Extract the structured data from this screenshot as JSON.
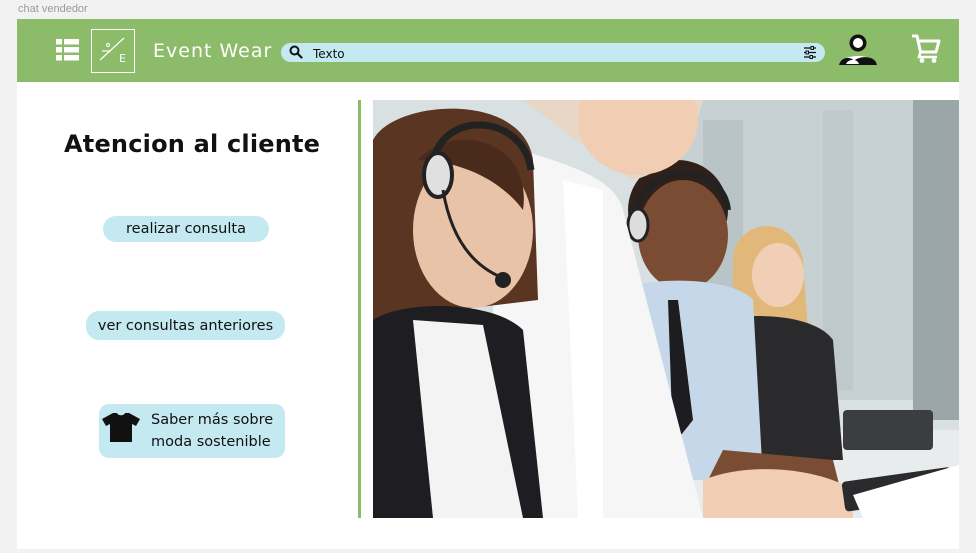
{
  "frame": {
    "label": "chat vendedor"
  },
  "header": {
    "brand": "Event Wear",
    "logo_text": "E",
    "search": {
      "value": "Texto",
      "placeholder": ""
    },
    "icons": [
      "menu-icon",
      "hanger-logo-icon",
      "search-icon",
      "filter-icon",
      "user-icon",
      "cart-icon"
    ]
  },
  "main": {
    "title": "Atencion al cliente",
    "buttons": {
      "consulta": "realizar consulta",
      "anteriores": "ver consultas anteriores",
      "saber_line1": "Saber más sobre",
      "saber_line2": "moda sostenible"
    },
    "image_alt": "call center agents wearing headsets at computers"
  },
  "colors": {
    "header_green": "#8cbb69",
    "pill_blue": "#c4e9f1",
    "divider_green": "#8cbb69"
  }
}
